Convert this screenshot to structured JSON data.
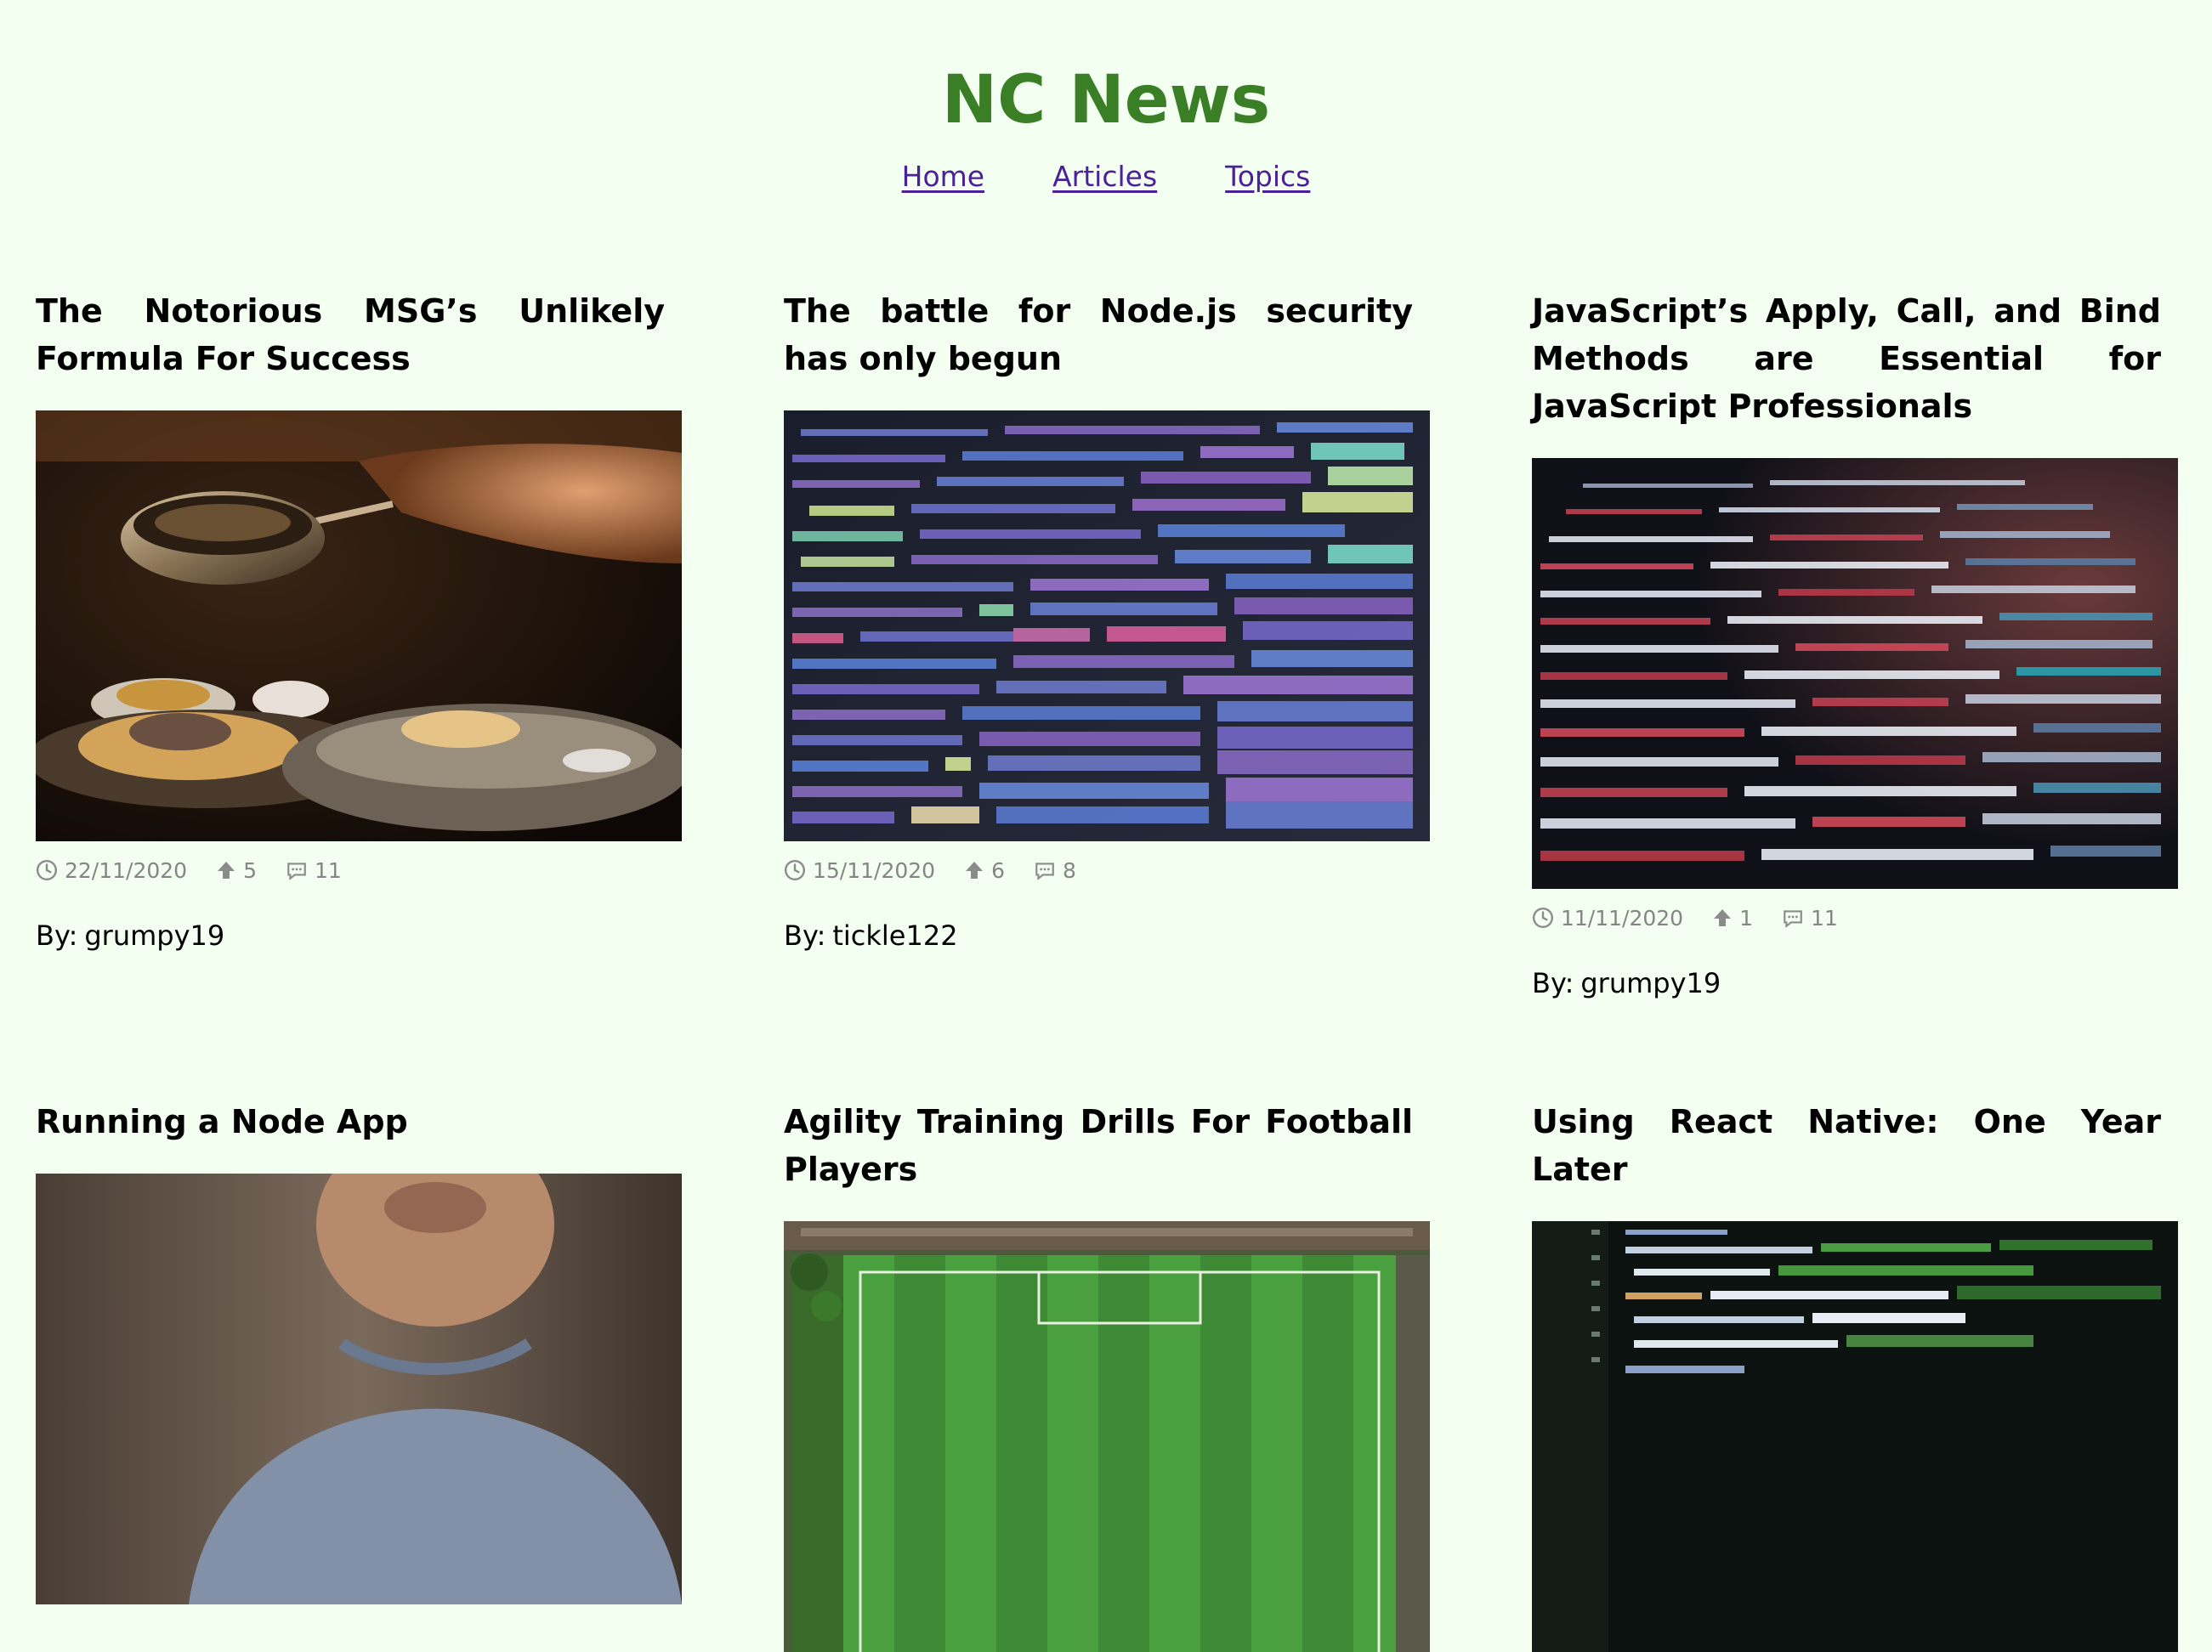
{
  "site": {
    "title": "NC News"
  },
  "nav": {
    "items": [
      {
        "label": "Home"
      },
      {
        "label": "Articles"
      },
      {
        "label": "Topics"
      }
    ]
  },
  "labels": {
    "by": "By:"
  },
  "articles": [
    {
      "title": "The Notorious MSG’s Unlikely Formula For Success",
      "date": "22/11/2020",
      "votes": "5",
      "comments": "11",
      "author": "grumpy19",
      "image": "food-pan-photo"
    },
    {
      "title": "The battle for Node.js security has only begun",
      "date": "15/11/2020",
      "votes": "6",
      "comments": "8",
      "author": "tickle122",
      "image": "colorful-code-photo"
    },
    {
      "title": "JavaScript’s Apply, Call, and Bind Methods are Essential for JavaScript Professionals",
      "date": "11/11/2020",
      "votes": "1",
      "comments": "11",
      "author": "grumpy19",
      "image": "red-code-photo"
    },
    {
      "title": "Running a Node App",
      "image": "person-photo"
    },
    {
      "title": "Agility Training Drills For Football Players",
      "image": "football-pitch-photo"
    },
    {
      "title": "Using React Native: One Year Later",
      "image": "green-code-photo"
    }
  ],
  "icons": {
    "clock": "clock-icon",
    "votes": "arrow-up-icon",
    "comments": "speech-bubble-icon"
  },
  "colors": {
    "background": "#f3fff0",
    "title": "#3a7e26",
    "link": "#4b2199",
    "meta": "#858585"
  }
}
